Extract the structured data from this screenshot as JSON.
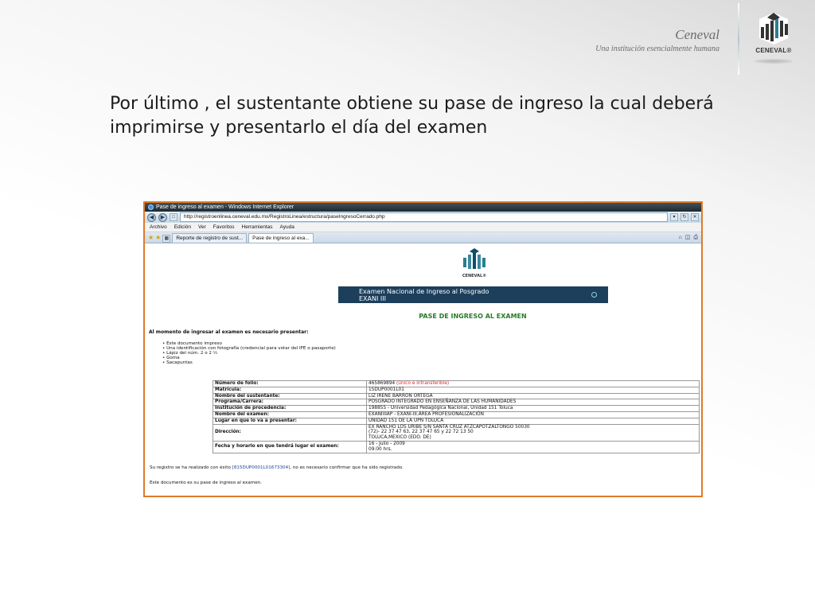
{
  "brand": {
    "name": "Ceneval",
    "tagline": "Una institución esencialmente humana",
    "logo_text": "CENEVAL®"
  },
  "slide": {
    "heading": "Por último , el sustentante obtiene su pase de ingreso la cual deberá imprimirse y presentarlo el día del examen"
  },
  "browser": {
    "window_title": "Pase de ingreso al examen - Windows Internet Explorer",
    "url": "http://registroenlinea.ceneval.edu.mx/RegistroLinea/estructura/paseIngresoCerrado.php",
    "menu": [
      "Archivo",
      "Edición",
      "Ver",
      "Favoritos",
      "Herramientas",
      "Ayuda"
    ],
    "tabs": [
      {
        "label": "Reporte de registro de sust..."
      },
      {
        "label": "Pase de ingreso al exa..."
      }
    ]
  },
  "page": {
    "logo_text": "CENEVAL®",
    "banner_line1": "Examen Nacional de Ingreso al Posgrado",
    "banner_line2": "EXANI III",
    "pass_title": "PASE DE INGRESO AL EXAMEN",
    "requirements_title": "Al momento de ingresar al examen es necesario presentar:",
    "requirements": [
      "Este documento impreso",
      "Una identificación con fotografía (credencial para votar del IFE o pasaporte)",
      "Lápiz del núm. 2 o 2 ½",
      "Goma",
      "Sacapuntas"
    ],
    "table": {
      "folio_label": "Número de folio:",
      "folio_value": "465869894",
      "folio_note": "(único e intransferible)",
      "matricula_label": "Matrícula:",
      "matricula_value": "15DUP0001L01",
      "nombre_label": "Nombre del sustentante:",
      "nombre_value": "LIZ IRENE BARRON ORTEGA",
      "programa_label": "Programa/Carrera:",
      "programa_value": "POSGRADO INTEGRADO EN ENSEÑANZA DE LAS HUMANIDADES",
      "institucion_label": "Institución de procedencia:",
      "institucion_value": "198855 - Universidad Pedagógica Nacional, Unidad 151 Toluca",
      "examen_label": "Nombre del examen:",
      "examen_value": "EXANIIIIAP - EXANI-III.ÁREA PROFESIONALIZACIÓN",
      "lugar_label": "Lugar en que lo va a presentar:",
      "lugar_value": "UNIDAD 151 DE LA UPN TOLUCA",
      "direccion_label": "Dirección:",
      "direccion_line1": "EX RANCHO LOS URIBE S/N SANTA CRUZ ATZCAPOTZALTONGO 50030",
      "direccion_line2": "(72)- 22 37 47 63, 22 37 47 65 y 22 72 13 50",
      "direccion_line3": "TOLUCA,MEXICO (EDO. DE)",
      "fecha_label": "Fecha y horario en que tendrá lugar el examen:",
      "fecha_line1": "16 - Julio - 2009",
      "fecha_line2": "09:00 hrs."
    },
    "footer_registry_prefix": "Su registro se ha realizado con éxito",
    "footer_registry_code": "[815DUP0001L01673304]",
    "footer_registry_suffix": ", no es necesario confirmar que ha sido registrado.",
    "footer_document": "Este documento es su pase de ingreso al examen."
  }
}
